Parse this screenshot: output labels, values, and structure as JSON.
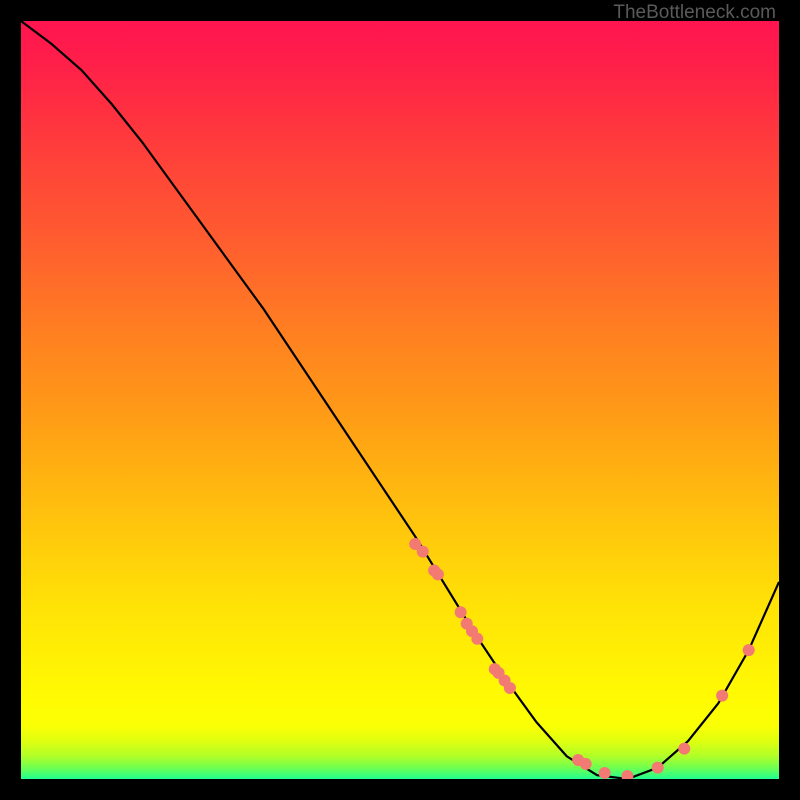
{
  "watermark": "TheBottleneck.com",
  "chart_data": {
    "type": "line",
    "title": "",
    "xlabel": "",
    "ylabel": "",
    "xlim": [
      0,
      100
    ],
    "ylim": [
      0,
      100
    ],
    "grid": false,
    "series": [
      {
        "name": "bottleneck-curve",
        "x": [
          0,
          4,
          8,
          12,
          16,
          20,
          24,
          28,
          32,
          36,
          40,
          44,
          48,
          52,
          56,
          60,
          64,
          68,
          72,
          76,
          80,
          84,
          88,
          92,
          96,
          100
        ],
        "values": [
          100,
          97,
          93.5,
          89,
          84,
          78.5,
          73,
          67.5,
          62,
          56,
          50,
          44,
          38,
          32,
          25.5,
          19,
          13,
          7.5,
          3,
          0.5,
          0,
          1.5,
          5,
          10,
          17,
          26
        ]
      }
    ],
    "marker_points": {
      "name": "highlight-dots",
      "color": "#f37a72",
      "x": [
        52,
        53,
        54.5,
        55,
        58,
        58.8,
        59.5,
        60.2,
        62.5,
        63,
        63.8,
        64.5,
        73.5,
        74.5,
        77,
        80,
        84,
        87.5,
        92.5,
        96
      ],
      "values": [
        31,
        30,
        27.5,
        27,
        22,
        20.5,
        19.5,
        18.5,
        14.5,
        14,
        13,
        12,
        2.5,
        2,
        0.8,
        0.4,
        1.5,
        4,
        11,
        17
      ]
    },
    "background_gradient": {
      "direction": "vertical",
      "stops": [
        {
          "pos": 0.0,
          "color": "#ff1450"
        },
        {
          "pos": 0.2,
          "color": "#ff4638"
        },
        {
          "pos": 0.42,
          "color": "#ff8220"
        },
        {
          "pos": 0.64,
          "color": "#ffbe0e"
        },
        {
          "pos": 0.84,
          "color": "#fff004"
        },
        {
          "pos": 0.95,
          "color": "#e0ff10"
        },
        {
          "pos": 1.0,
          "color": "#20ff90"
        }
      ]
    }
  }
}
